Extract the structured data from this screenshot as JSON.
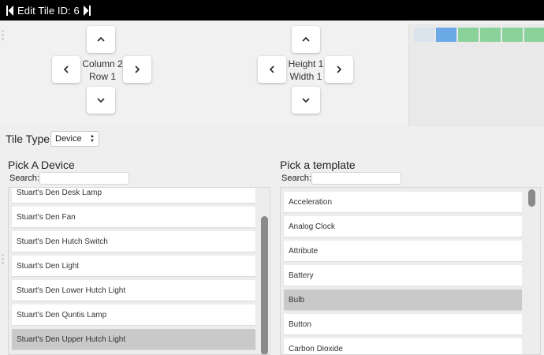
{
  "titlebar": {
    "title": "Edit Tile ID: 6",
    "prev_icon": "skip-back-icon",
    "next_icon": "skip-forward-icon"
  },
  "position": {
    "column_label": "Column 2",
    "row_label": "Row 1"
  },
  "size": {
    "height_label": "Height 1",
    "width_label": "Width 1"
  },
  "preview_colors": {
    "empty": "#dbe3ec",
    "current": "#6aa8e6",
    "occupied": "#8ad19a"
  },
  "tile_type": {
    "label": "Tile Type:",
    "selected": "Device"
  },
  "device_section": {
    "title": "Pick A Device",
    "search_label": "Search:",
    "search_value": "",
    "items": [
      "Stuart's Den Desk Lamp",
      "Stuart's Den Fan",
      "Stuart's Den Hutch Switch",
      "Stuart's Den Light",
      "Stuart's Den Lower Hutch Light",
      "Stuart's Den Quntis Lamp",
      "Stuart's Den Upper Hutch Light"
    ],
    "selected_index": 6
  },
  "template_section": {
    "title": "Pick a template",
    "search_label": "Search:",
    "search_value": "",
    "items": [
      "Acceleration",
      "Analog Clock",
      "Attribute",
      "Battery",
      "Bulb",
      "Button",
      "Carbon Dioxide"
    ],
    "selected_index": 4
  }
}
